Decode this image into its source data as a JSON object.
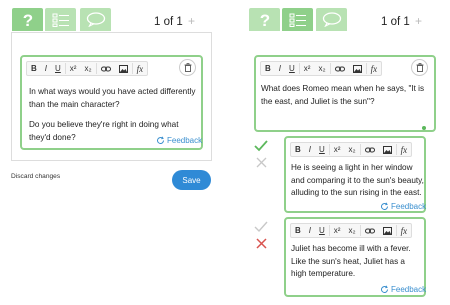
{
  "left": {
    "pager": {
      "current": "1",
      "total": "1",
      "text": "1 of 1",
      "plus": "+"
    },
    "editor": {
      "toolbar": {
        "bold": "B",
        "italic": "I",
        "underline": "U",
        "superscript": "x²",
        "subscript": "x₂",
        "formula": "fx"
      },
      "paragraph1": "In what ways would you have acted differently than the main character?",
      "paragraph2": "Do you believe they're right in doing what they'd done?",
      "feedback_label": "Feedback"
    },
    "discard_label": "Discard changes",
    "save_label": "Save"
  },
  "right": {
    "pager": {
      "text": "1 of 1",
      "plus": "+"
    },
    "question": {
      "text": "What does Romeo mean when he says, \"It is the east, and Juliet is the sun\"?"
    },
    "answers": [
      {
        "text": "He is seeing a light in her window and comparing it to the sun's beauty, alluding to the sun rising in the east.",
        "feedback_label": "Feedback",
        "correct": true
      },
      {
        "text": "Juliet has become ill with a fever. Like the sun's heat, Juliet has a high temperature.",
        "feedback_label": "Feedback",
        "correct": false
      }
    ]
  },
  "colors": {
    "green": "#8fd08a",
    "blue": "#2f8ad6",
    "red": "#d9534f"
  },
  "icons": [
    "question-icon",
    "list-icon",
    "chat-bubble-icon",
    "trash-icon",
    "link-icon",
    "image-icon",
    "refresh-icon",
    "check-icon",
    "x-icon"
  ]
}
